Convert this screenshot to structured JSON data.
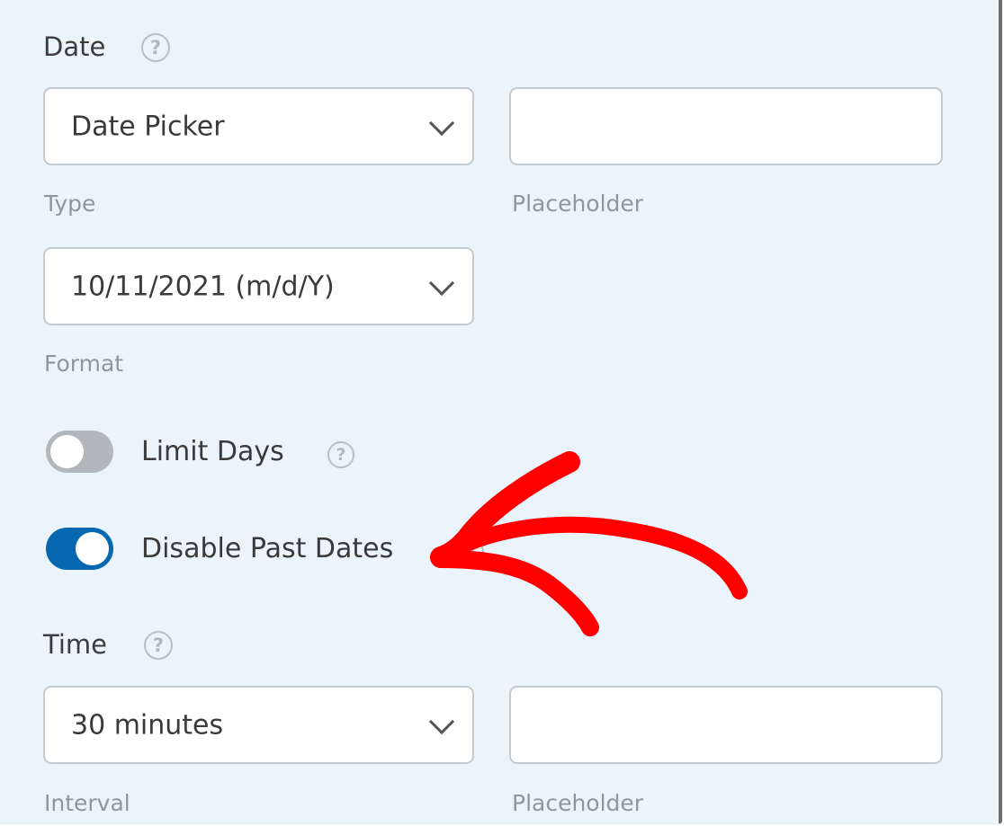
{
  "date_section": {
    "title": "Date",
    "help_icon": "question-circle-icon",
    "type_select": {
      "value": "Date Picker",
      "label": "Type"
    },
    "placeholder_input": {
      "value": "",
      "label": "Placeholder"
    },
    "format_select": {
      "value": "10/11/2021 (m/d/Y)",
      "label": "Format"
    }
  },
  "toggles": [
    {
      "label": "Limit Days",
      "enabled": false,
      "help_icon": "question-circle-icon"
    },
    {
      "label": "Disable Past Dates",
      "enabled": true,
      "help_icon": "question-circle-icon"
    }
  ],
  "time_section": {
    "title": "Time",
    "help_icon": "question-circle-icon",
    "interval_select": {
      "value": "30 minutes",
      "label": "Interval"
    },
    "placeholder_input": {
      "value": "",
      "label": "Placeholder"
    }
  },
  "annotation": {
    "type": "hand-drawn-arrow",
    "color": "#ff0000",
    "points_to": "Disable Past Dates"
  },
  "colors": {
    "background": "#ebf3fb",
    "toggle_on": "#0667b1",
    "toggle_off": "#b3b6ba"
  },
  "help_glyph": "?"
}
